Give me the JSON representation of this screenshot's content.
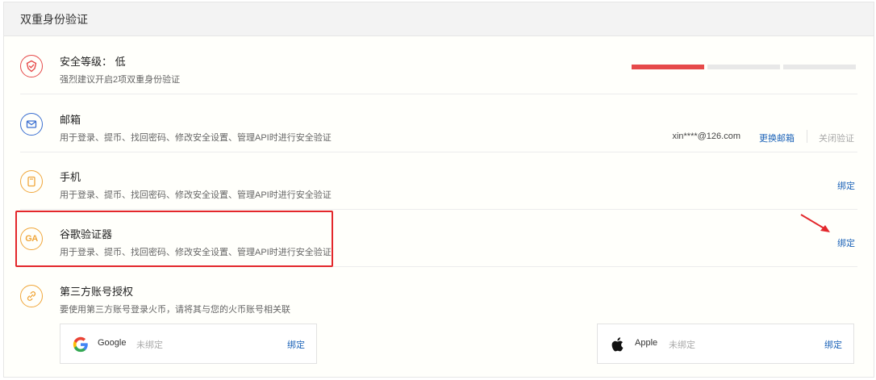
{
  "header": {
    "title": "双重身份验证"
  },
  "security_level": {
    "title": "安全等级：  低",
    "desc": "强烈建议开启2项双重身份验证",
    "level_fraction": 0.33,
    "colors": {
      "active": "#e64a4a",
      "inactive": "#e8e8e8"
    }
  },
  "email": {
    "title": "邮箱",
    "desc": "用于登录、提币、找回密码、修改安全设置、管理API时进行安全验证",
    "value": "xin****@126.com",
    "change_label": "更换邮箱",
    "close_label": "关闭验证"
  },
  "phone": {
    "title": "手机",
    "desc": "用于登录、提币、找回密码、修改安全设置、管理API时进行安全验证",
    "bind_label": "绑定"
  },
  "google_auth": {
    "title": "谷歌验证器",
    "desc": "用于登录、提币、找回密码、修改安全设置、管理API时进行安全验证",
    "icon_text": "GA",
    "bind_label": "绑定"
  },
  "third_party": {
    "title": "第三方账号授权",
    "desc": "要使用第三方账号登录火币，请将其与您的火币账号相关联",
    "accounts": [
      {
        "name": "Google",
        "state": "未绑定",
        "bind_label": "绑定",
        "icon": "google-icon"
      },
      {
        "name": "Apple",
        "state": "未绑定",
        "bind_label": "绑定",
        "icon": "apple-icon"
      }
    ]
  },
  "colors": {
    "red": "#e64a4a",
    "blue": "#3b6fd1",
    "orange": "#f0a63a",
    "link": "#1c63b8",
    "highlight": "#e3272b"
  }
}
